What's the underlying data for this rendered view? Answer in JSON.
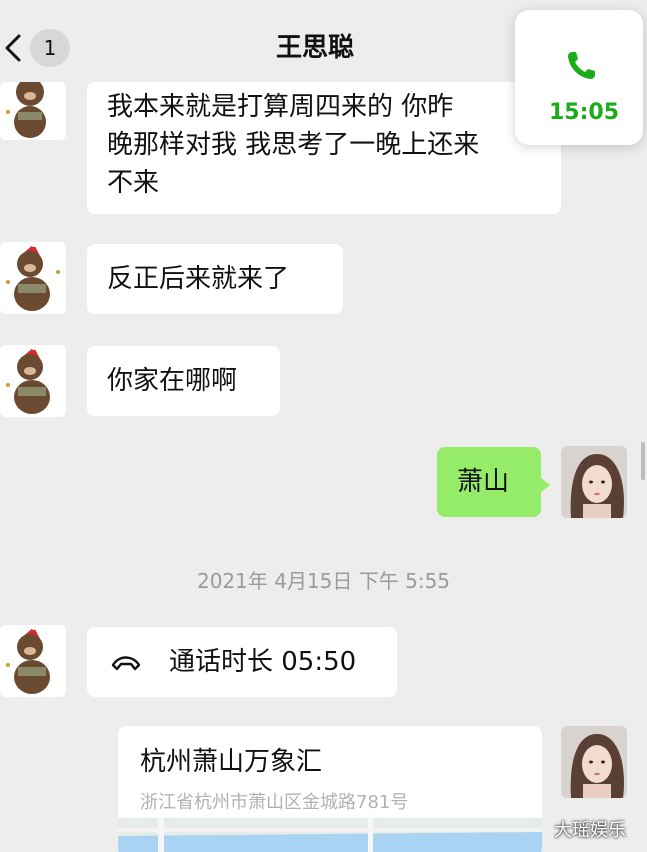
{
  "header": {
    "title": "王思聪",
    "badge": "1",
    "back_icon": "chevron-left-icon"
  },
  "call_widget": {
    "icon": "phone-icon",
    "duration": "15:05",
    "color": "#1aad19"
  },
  "messages": [
    {
      "sender": "other",
      "lines": [
        "我本来就是打算周四来的  你昨",
        "晚那样对我 我思考了一晚上还来",
        "不来"
      ]
    },
    {
      "sender": "other",
      "text": "反正后来就来了"
    },
    {
      "sender": "other",
      "text": "你家在哪啊"
    },
    {
      "sender": "me",
      "text": "萧山"
    }
  ],
  "timestamp": "2021年 4月15日  下午 5:55",
  "call_record": {
    "icon": "hang-up-icon",
    "text": "通话时长 05:50"
  },
  "location": {
    "name": "杭州萧山万象汇",
    "address": "浙江省杭州市萧山区金城路781号"
  },
  "watermark": "大瑶娱乐",
  "colors": {
    "background": "#ededed",
    "my_bubble": "#95ec69",
    "other_bubble": "#ffffff",
    "accent_green": "#1aad19"
  }
}
